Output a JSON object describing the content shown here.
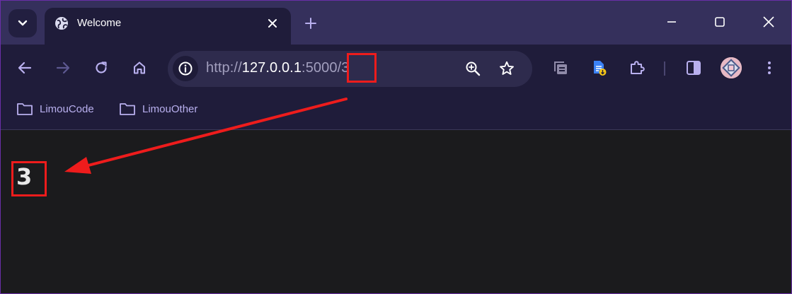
{
  "tab": {
    "title": "Welcome"
  },
  "omnibox": {
    "url_scheme": "http://",
    "url_host": "127.0.0.1",
    "url_rest": ":5000/3"
  },
  "bookmarks": [
    {
      "label": "LimouCode"
    },
    {
      "label": "LimouOther"
    }
  ],
  "page": {
    "number": "3"
  },
  "colors": {
    "annotation": "#ee1c1c",
    "tabstrip": "#35305c",
    "toolbar": "#1f1c3a",
    "page_background": "#1b1b1d"
  }
}
